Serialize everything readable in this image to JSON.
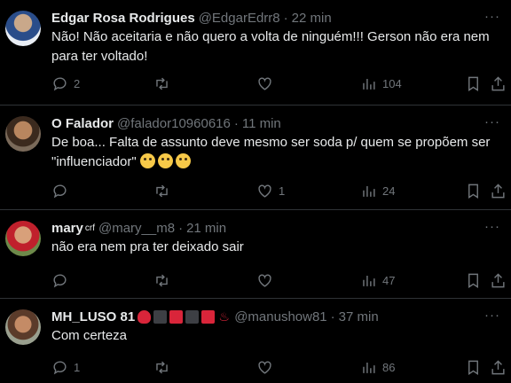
{
  "tweets": [
    {
      "name": "Edgar Rosa Rodrigues",
      "handle": "@EdgarEdrr8",
      "time": "22 min",
      "text": "Não! Não aceitaria e não quero a volta de ninguém!!! Gerson não era nem para ter voltado!",
      "replies": "2",
      "retweets": "",
      "likes": "",
      "views": "104"
    },
    {
      "name": "O Falador",
      "handle": "@falador10960616",
      "time": "11 min",
      "text": "De boa... Falta de assunto deve mesmo ser soda p/ quem se propõem ser \"influenciador\"",
      "replies": "",
      "retweets": "",
      "likes": "1",
      "views": "24"
    },
    {
      "name": "mary",
      "badge": "crf",
      "handle": "@mary__m8",
      "time": "21 min",
      "text": "não era nem pra ter deixado sair",
      "replies": "",
      "retweets": "",
      "likes": "",
      "views": "47"
    },
    {
      "name": "MH_LUSO 81",
      "handle": "@manushow81",
      "time": "37 min",
      "text": "Com certeza",
      "replies": "1",
      "retweets": "",
      "likes": "",
      "views": "86"
    }
  ],
  "ui": {
    "dot": "·",
    "more": "···"
  },
  "icons": [
    "reply-icon",
    "retweet-icon",
    "like-icon",
    "views-icon",
    "bookmark-icon",
    "share-icon",
    "more-icon"
  ],
  "colors": {
    "background": "#000000",
    "text": "#e7e9ea",
    "muted": "#71767b",
    "divider": "#2f3336"
  }
}
